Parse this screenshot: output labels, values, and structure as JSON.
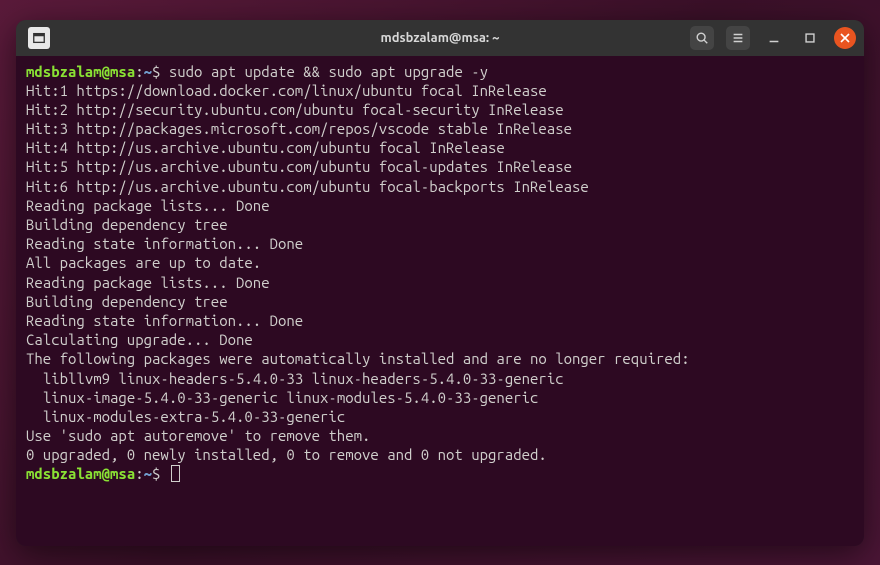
{
  "titlebar": {
    "title": "mdsbzalam@msa: ~"
  },
  "prompt": {
    "user": "mdsbzalam",
    "host": "msa",
    "path": "~",
    "symbol": "$"
  },
  "command": "sudo apt update && sudo apt upgrade -y",
  "output": [
    "Hit:1 https://download.docker.com/linux/ubuntu focal InRelease",
    "Hit:2 http://security.ubuntu.com/ubuntu focal-security InRelease",
    "Hit:3 http://packages.microsoft.com/repos/vscode stable InRelease",
    "Hit:4 http://us.archive.ubuntu.com/ubuntu focal InRelease",
    "Hit:5 http://us.archive.ubuntu.com/ubuntu focal-updates InRelease",
    "Hit:6 http://us.archive.ubuntu.com/ubuntu focal-backports InRelease",
    "Reading package lists... Done",
    "Building dependency tree",
    "Reading state information... Done",
    "All packages are up to date.",
    "Reading package lists... Done",
    "Building dependency tree",
    "Reading state information... Done",
    "Calculating upgrade... Done",
    "The following packages were automatically installed and are no longer required:",
    "  libllvm9 linux-headers-5.4.0-33 linux-headers-5.4.0-33-generic",
    "  linux-image-5.4.0-33-generic linux-modules-5.4.0-33-generic",
    "  linux-modules-extra-5.4.0-33-generic",
    "Use 'sudo apt autoremove' to remove them.",
    "0 upgraded, 0 newly installed, 0 to remove and 0 not upgraded."
  ]
}
